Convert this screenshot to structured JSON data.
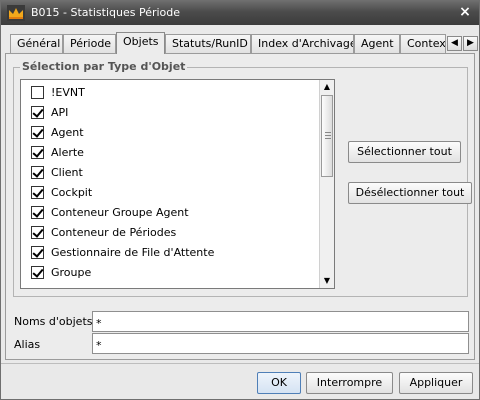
{
  "window": {
    "title": "B015 - Statistiques Période",
    "close_glyph": "×"
  },
  "tabs": [
    {
      "label": "Général",
      "active": false
    },
    {
      "label": "Période",
      "active": false
    },
    {
      "label": "Objets",
      "active": true
    },
    {
      "label": "Statuts/RunID",
      "active": false
    },
    {
      "label": "Index d'Archivage",
      "active": false
    },
    {
      "label": "Agent",
      "active": false
    },
    {
      "label": "Contexte",
      "active": false
    }
  ],
  "tab_scroll": {
    "left_glyph": "◀",
    "right_glyph": "▶"
  },
  "group": {
    "title": "Sélection par Type d'Objet"
  },
  "object_types": [
    {
      "label": "!EVNT",
      "checked": false
    },
    {
      "label": "API",
      "checked": true
    },
    {
      "label": "Agent",
      "checked": true
    },
    {
      "label": "Alerte",
      "checked": true
    },
    {
      "label": "Client",
      "checked": true
    },
    {
      "label": "Cockpit",
      "checked": true
    },
    {
      "label": "Conteneur Groupe Agent",
      "checked": true
    },
    {
      "label": "Conteneur de Périodes",
      "checked": true
    },
    {
      "label": "Gestionnaire de File d'Attente",
      "checked": true
    },
    {
      "label": "Groupe",
      "checked": true
    }
  ],
  "scrollbar": {
    "up_glyph": "▲",
    "down_glyph": "▼"
  },
  "side_buttons": {
    "select_all": "Sélectionner tout",
    "deselect_all": "Désélectionner tout"
  },
  "fields": {
    "object_names": {
      "label": "Noms d'objets:",
      "value": "*"
    },
    "alias": {
      "label": "Alias",
      "value": "*"
    }
  },
  "footer": {
    "ok": "OK",
    "interrupt": "Interrompre",
    "apply": "Appliquer"
  },
  "colors": {
    "titlebar": "#4b4b4b",
    "window_bg": "#e9e9e9",
    "default_button_border": "#4f7fb7"
  }
}
